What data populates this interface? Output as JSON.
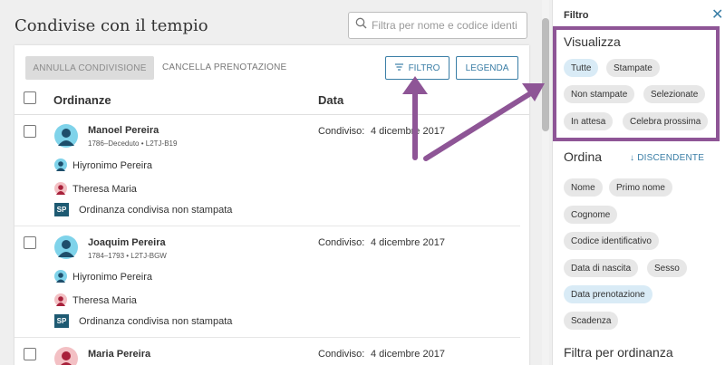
{
  "page": {
    "title": "Condivise con il tempio"
  },
  "search": {
    "placeholder": "Filtra per nome e codice identi"
  },
  "toolbar": {
    "unshare_label": "ANNULLA CONDIVISIONE",
    "cancel_label": "CANCELLA PRENOTAZIONE",
    "filter_label": "FILTRO",
    "legend_label": "LEGENDA"
  },
  "table": {
    "col_ordinances": "Ordinanze",
    "col_date": "Data"
  },
  "rows": [
    {
      "name": "Manoel Pereira",
      "meta": "1786–Deceduto •  L2TJ-B19",
      "gender": "male",
      "shared_label": "Condiviso:",
      "shared_date": "4 dicembre 2017",
      "relatives": [
        "Hiyronimo Pereira",
        "Theresa Maria"
      ],
      "sp_badge": "SP",
      "sp_text": "Ordinanza condivisa non stampata"
    },
    {
      "name": "Joaquim Pereira",
      "meta": "1784–1793 •  L2TJ-BGW",
      "gender": "male",
      "shared_label": "Condiviso:",
      "shared_date": "4 dicembre 2017",
      "relatives": [
        "Hiyronimo Pereira",
        "Theresa Maria"
      ],
      "sp_badge": "SP",
      "sp_text": "Ordinanza condivisa non stampata"
    },
    {
      "name": "Maria Pereira",
      "gender": "female",
      "shared_label": "Condiviso:",
      "shared_date": "4 dicembre 2017"
    }
  ],
  "panel": {
    "title": "Filtro",
    "close_icon": "close-icon",
    "view_title": "Visualizza",
    "view_chips": [
      "Tutte",
      "Stampate",
      "Non stampate",
      "Selezionate",
      "In attesa",
      "Celebra prossima"
    ],
    "view_selected": "Tutte",
    "sort_title": "Ordina",
    "sort_direction": "DISCENDENTE",
    "sort_chips": [
      "Nome",
      "Primo nome",
      "Cognome",
      "Codice identificativo",
      "Data di nascita",
      "Sesso",
      "Data prenotazione",
      "Scadenza"
    ],
    "sort_selected": "Data prenotazione",
    "filter_by_title": "Filtra per ordinanza"
  },
  "colors": {
    "accent": "#3a7ea6",
    "annotation": "#8e5596",
    "chip_selected": "#d9ebf6",
    "sp_badge": "#1e5a72"
  }
}
